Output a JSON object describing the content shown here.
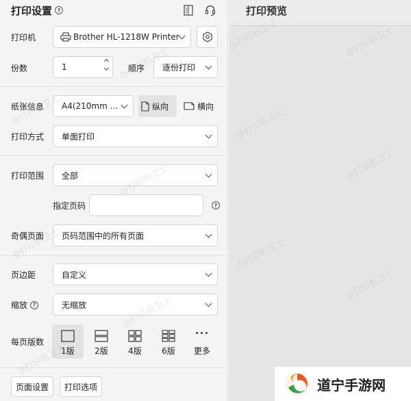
{
  "header": {
    "title": "打印设置",
    "help_glyph": "?"
  },
  "printer": {
    "label": "打印机",
    "value": "Brother HL-1218W Printer"
  },
  "copies": {
    "label": "份数",
    "value": "1"
  },
  "order": {
    "label": "顺序",
    "value": "逐份打印"
  },
  "paper": {
    "label": "纸张信息",
    "value": "A4(210mm ...",
    "portrait": "纵向",
    "landscape": "横向"
  },
  "mode": {
    "label": "打印方式",
    "value": "单面打印"
  },
  "range": {
    "label": "打印范围",
    "value": "全部"
  },
  "pages": {
    "label": "指定页码",
    "value": "",
    "help_glyph": "?"
  },
  "parity": {
    "label": "奇偶页面",
    "value": "页码范围中的所有页面"
  },
  "margin": {
    "label": "页边距",
    "value": "自定义"
  },
  "scale": {
    "label": "缩放",
    "value": "无缩放",
    "help_glyph": "?"
  },
  "per_page": {
    "label": "每页版数",
    "options": [
      "1版",
      "2版",
      "4版",
      "6版",
      "更多"
    ],
    "more_glyph": "•••"
  },
  "footer": {
    "page_setup": "页面设置",
    "print_options": "打印选项"
  },
  "preview": {
    "title": "打印预览"
  },
  "watermark": "@打印机卫士",
  "badge": {
    "text": "道宁手游网"
  },
  "colors": {
    "panel": "#f5f5f5",
    "preview": "#e6e6e6",
    "selected": "#e2e2e2"
  }
}
